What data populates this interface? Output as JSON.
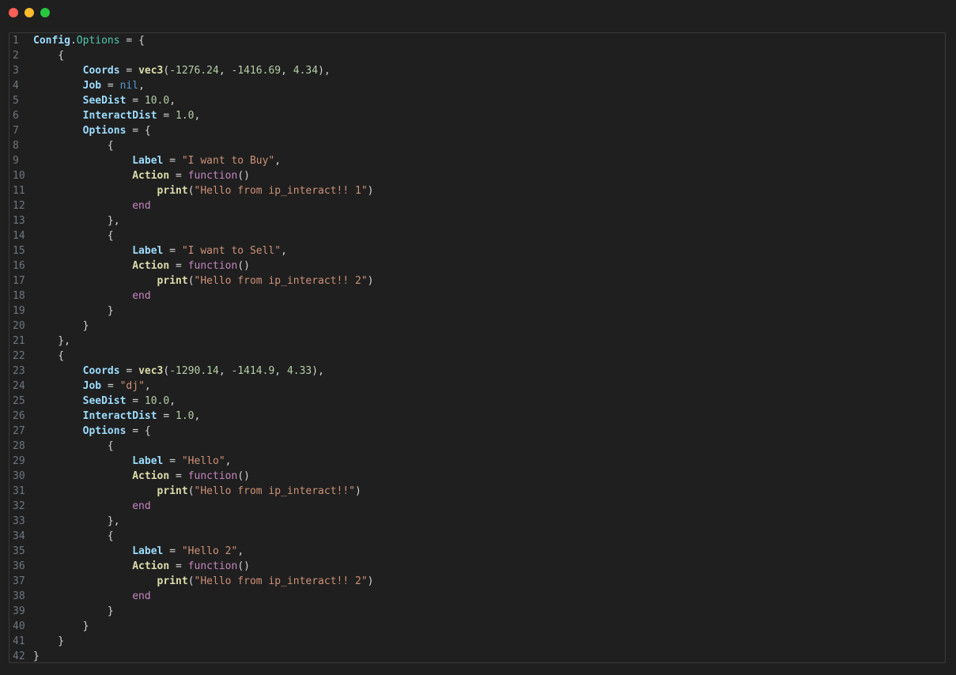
{
  "window": {
    "controls": {
      "close_color": "#ff5f57",
      "minimize_color": "#febc2e",
      "maximize_color": "#28c840"
    }
  },
  "editor": {
    "language": "lua",
    "lines": [
      {
        "n": "1",
        "tokens": [
          [
            "k",
            "Config"
          ],
          [
            "p",
            "."
          ],
          [
            "ty",
            "Options"
          ],
          [
            "p",
            " = {"
          ]
        ]
      },
      {
        "n": "2",
        "tokens": [
          [
            "p",
            "    {"
          ]
        ]
      },
      {
        "n": "3",
        "tokens": [
          [
            "p",
            "        "
          ],
          [
            "k",
            "Coords"
          ],
          [
            "p",
            " = "
          ],
          [
            "kf",
            "vec3"
          ],
          [
            "p",
            "("
          ],
          [
            "num",
            "-1276.24"
          ],
          [
            "p",
            ", "
          ],
          [
            "num",
            "-1416.69"
          ],
          [
            "p",
            ", "
          ],
          [
            "num",
            "4.34"
          ],
          [
            "p",
            "),"
          ]
        ]
      },
      {
        "n": "4",
        "tokens": [
          [
            "p",
            "        "
          ],
          [
            "k",
            "Job"
          ],
          [
            "p",
            " = "
          ],
          [
            "nil",
            "nil"
          ],
          [
            "p",
            ","
          ]
        ]
      },
      {
        "n": "5",
        "tokens": [
          [
            "p",
            "        "
          ],
          [
            "k",
            "SeeDist"
          ],
          [
            "p",
            " = "
          ],
          [
            "num",
            "10.0"
          ],
          [
            "p",
            ","
          ]
        ]
      },
      {
        "n": "6",
        "tokens": [
          [
            "p",
            "        "
          ],
          [
            "k",
            "InteractDist"
          ],
          [
            "p",
            " = "
          ],
          [
            "num",
            "1.0"
          ],
          [
            "p",
            ","
          ]
        ]
      },
      {
        "n": "7",
        "tokens": [
          [
            "p",
            "        "
          ],
          [
            "k",
            "Options"
          ],
          [
            "p",
            " = {"
          ]
        ]
      },
      {
        "n": "8",
        "tokens": [
          [
            "p",
            "            {"
          ]
        ]
      },
      {
        "n": "9",
        "tokens": [
          [
            "p",
            "                "
          ],
          [
            "k",
            "Label"
          ],
          [
            "p",
            " = "
          ],
          [
            "str",
            "\"I want to Buy\""
          ],
          [
            "p",
            ","
          ]
        ]
      },
      {
        "n": "10",
        "tokens": [
          [
            "p",
            "                "
          ],
          [
            "kf",
            "Action"
          ],
          [
            "p",
            " = "
          ],
          [
            "kw",
            "function"
          ],
          [
            "p",
            "()"
          ]
        ]
      },
      {
        "n": "11",
        "tokens": [
          [
            "p",
            "                    "
          ],
          [
            "kf",
            "print"
          ],
          [
            "p",
            "("
          ],
          [
            "str",
            "\"Hello from ip_interact!! 1\""
          ],
          [
            "p",
            ")"
          ]
        ]
      },
      {
        "n": "12",
        "tokens": [
          [
            "p",
            "                "
          ],
          [
            "kw",
            "end"
          ]
        ]
      },
      {
        "n": "13",
        "tokens": [
          [
            "p",
            "            },"
          ]
        ]
      },
      {
        "n": "14",
        "tokens": [
          [
            "p",
            "            {"
          ]
        ]
      },
      {
        "n": "15",
        "tokens": [
          [
            "p",
            "                "
          ],
          [
            "k",
            "Label"
          ],
          [
            "p",
            " = "
          ],
          [
            "str",
            "\"I want to Sell\""
          ],
          [
            "p",
            ","
          ]
        ]
      },
      {
        "n": "16",
        "tokens": [
          [
            "p",
            "                "
          ],
          [
            "kf",
            "Action"
          ],
          [
            "p",
            " = "
          ],
          [
            "kw",
            "function"
          ],
          [
            "p",
            "()"
          ]
        ]
      },
      {
        "n": "17",
        "tokens": [
          [
            "p",
            "                    "
          ],
          [
            "kf",
            "print"
          ],
          [
            "p",
            "("
          ],
          [
            "str",
            "\"Hello from ip_interact!! 2\""
          ],
          [
            "p",
            ")"
          ]
        ]
      },
      {
        "n": "18",
        "tokens": [
          [
            "p",
            "                "
          ],
          [
            "kw",
            "end"
          ]
        ]
      },
      {
        "n": "19",
        "tokens": [
          [
            "p",
            "            }"
          ]
        ]
      },
      {
        "n": "20",
        "tokens": [
          [
            "p",
            "        }"
          ]
        ]
      },
      {
        "n": "21",
        "tokens": [
          [
            "p",
            "    },"
          ]
        ]
      },
      {
        "n": "22",
        "tokens": [
          [
            "p",
            "    {"
          ]
        ]
      },
      {
        "n": "23",
        "tokens": [
          [
            "p",
            "        "
          ],
          [
            "k",
            "Coords"
          ],
          [
            "p",
            " = "
          ],
          [
            "kf",
            "vec3"
          ],
          [
            "p",
            "("
          ],
          [
            "num",
            "-1290.14"
          ],
          [
            "p",
            ", "
          ],
          [
            "num",
            "-1414.9"
          ],
          [
            "p",
            ", "
          ],
          [
            "num",
            "4.33"
          ],
          [
            "p",
            "),"
          ]
        ]
      },
      {
        "n": "24",
        "tokens": [
          [
            "p",
            "        "
          ],
          [
            "k",
            "Job"
          ],
          [
            "p",
            " = "
          ],
          [
            "str",
            "\"dj\""
          ],
          [
            "p",
            ","
          ]
        ]
      },
      {
        "n": "25",
        "tokens": [
          [
            "p",
            "        "
          ],
          [
            "k",
            "SeeDist"
          ],
          [
            "p",
            " = "
          ],
          [
            "num",
            "10.0"
          ],
          [
            "p",
            ","
          ]
        ]
      },
      {
        "n": "26",
        "tokens": [
          [
            "p",
            "        "
          ],
          [
            "k",
            "InteractDist"
          ],
          [
            "p",
            " = "
          ],
          [
            "num",
            "1.0"
          ],
          [
            "p",
            ","
          ]
        ]
      },
      {
        "n": "27",
        "tokens": [
          [
            "p",
            "        "
          ],
          [
            "k",
            "Options"
          ],
          [
            "p",
            " = {"
          ]
        ]
      },
      {
        "n": "28",
        "tokens": [
          [
            "p",
            "            {"
          ]
        ]
      },
      {
        "n": "29",
        "tokens": [
          [
            "p",
            "                "
          ],
          [
            "k",
            "Label"
          ],
          [
            "p",
            " = "
          ],
          [
            "str",
            "\"Hello\""
          ],
          [
            "p",
            ","
          ]
        ]
      },
      {
        "n": "30",
        "tokens": [
          [
            "p",
            "                "
          ],
          [
            "kf",
            "Action"
          ],
          [
            "p",
            " = "
          ],
          [
            "kw",
            "function"
          ],
          [
            "p",
            "()"
          ]
        ]
      },
      {
        "n": "31",
        "tokens": [
          [
            "p",
            "                    "
          ],
          [
            "kf",
            "print"
          ],
          [
            "p",
            "("
          ],
          [
            "str",
            "\"Hello from ip_interact!!\""
          ],
          [
            "p",
            ")"
          ]
        ]
      },
      {
        "n": "32",
        "tokens": [
          [
            "p",
            "                "
          ],
          [
            "kw",
            "end"
          ]
        ]
      },
      {
        "n": "33",
        "tokens": [
          [
            "p",
            "            },"
          ]
        ]
      },
      {
        "n": "34",
        "tokens": [
          [
            "p",
            "            {"
          ]
        ]
      },
      {
        "n": "35",
        "tokens": [
          [
            "p",
            "                "
          ],
          [
            "k",
            "Label"
          ],
          [
            "p",
            " = "
          ],
          [
            "str",
            "\"Hello 2\""
          ],
          [
            "p",
            ","
          ]
        ]
      },
      {
        "n": "36",
        "tokens": [
          [
            "p",
            "                "
          ],
          [
            "kf",
            "Action"
          ],
          [
            "p",
            " = "
          ],
          [
            "kw",
            "function"
          ],
          [
            "p",
            "()"
          ]
        ]
      },
      {
        "n": "37",
        "tokens": [
          [
            "p",
            "                    "
          ],
          [
            "kf",
            "print"
          ],
          [
            "p",
            "("
          ],
          [
            "str",
            "\"Hello from ip_interact!! 2\""
          ],
          [
            "p",
            ")"
          ]
        ]
      },
      {
        "n": "38",
        "tokens": [
          [
            "p",
            "                "
          ],
          [
            "kw",
            "end"
          ]
        ]
      },
      {
        "n": "39",
        "tokens": [
          [
            "p",
            "            }"
          ]
        ]
      },
      {
        "n": "40",
        "tokens": [
          [
            "p",
            "        }"
          ]
        ]
      },
      {
        "n": "41",
        "tokens": [
          [
            "p",
            "    }"
          ]
        ]
      },
      {
        "n": "42",
        "tokens": [
          [
            "p",
            "}"
          ]
        ]
      }
    ]
  }
}
